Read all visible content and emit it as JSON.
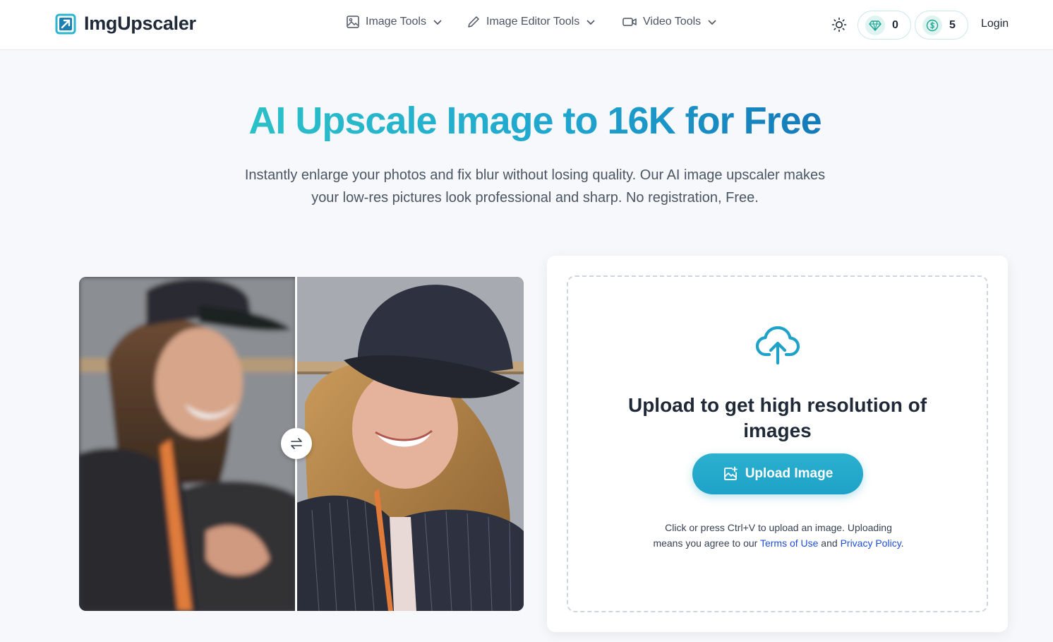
{
  "header": {
    "brand": "ImgUpscaler",
    "nav": [
      {
        "label": "Image Tools",
        "icon": "image-icon"
      },
      {
        "label": "Image Editor Tools",
        "icon": "pencil-icon"
      },
      {
        "label": "Video Tools",
        "icon": "video-icon"
      }
    ],
    "gems_count": "0",
    "coins_count": "5",
    "login_label": "Login"
  },
  "hero": {
    "title": "AI Upscale Image to 16K for Free",
    "subtitle": "Instantly enlarge your photos and fix blur without losing quality. Our AI image upscaler makes your low-res pictures look professional and sharp. No registration, Free."
  },
  "upload": {
    "heading": "Upload to get high resolution of images",
    "button_label": "Upload Image",
    "note_prefix": "Click or press Ctrl+V to upload an image. Uploading means you agree to our ",
    "terms_link": "Terms of Use",
    "note_and": " and ",
    "privacy_link": "Privacy Policy",
    "note_suffix": "."
  },
  "colors": {
    "accent": "#1ea2c8",
    "title_gradient_start": "#2cc0c9",
    "title_gradient_end": "#1479b9",
    "link": "#1d4ed8"
  }
}
